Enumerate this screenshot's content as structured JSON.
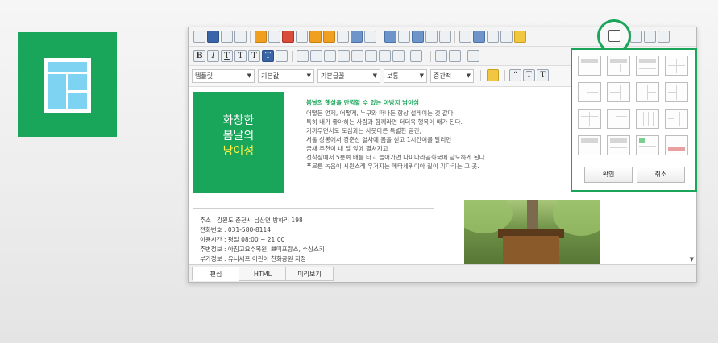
{
  "brand_tile": {
    "color": "#1aa65a",
    "icon": "layout-template-icon"
  },
  "editor": {
    "fonts_row": {
      "template_select": "템플릿",
      "style_select": "기본값",
      "font_select": "기본글꼴",
      "weight_select": "보통",
      "size_select": "중간적"
    },
    "promo": {
      "line1": "화창한",
      "line2": "봄날의",
      "line3": "낭이성"
    },
    "text": {
      "heading": "봄날의 햇살을 만끽할 수 있는 아방지 남이섬",
      "lines": [
        "어떻든 언제, 어떻게, 누구와 떠나든 항상 설레이는 것 같다.",
        "특히 내가 좋아하는 사람과 함께라면 더더욱 행복이 배가 된다.",
        "가까우면서도 도심과는 사뭇다른 특별한 공간,",
        "서울 상봉에서 경춘선 열차에 몸을 싣고 1시간여를 달리면",
        "금새 추천이 내 발 앞에 펼쳐지고",
        "선착장에서 5분여 배를 타고 들어가면 나미나라공화국에 당도하게 된다.",
        "푸르른 녹음이 시원스레 우거지는 메타세쿼이아 길이 기다리는 그 곳."
      ]
    },
    "info": [
      "주소 : 강원도 춘천시 남산면 방하리 198",
      "전화번호 : 031-580-8114",
      "이용시간 : 평일 08:00 ~ 21:00",
      "주변정보 : 아침고요수목원, 쁘띠프랑스, 수상스키",
      "부가정보 : 유니세프 어린이 친화공원 지정"
    ],
    "tabs": [
      "편집",
      "HTML",
      "미리보기"
    ]
  },
  "layout_popup": {
    "confirm_label": "확인",
    "cancel_label": "취소",
    "accent": "#1aa65a"
  }
}
